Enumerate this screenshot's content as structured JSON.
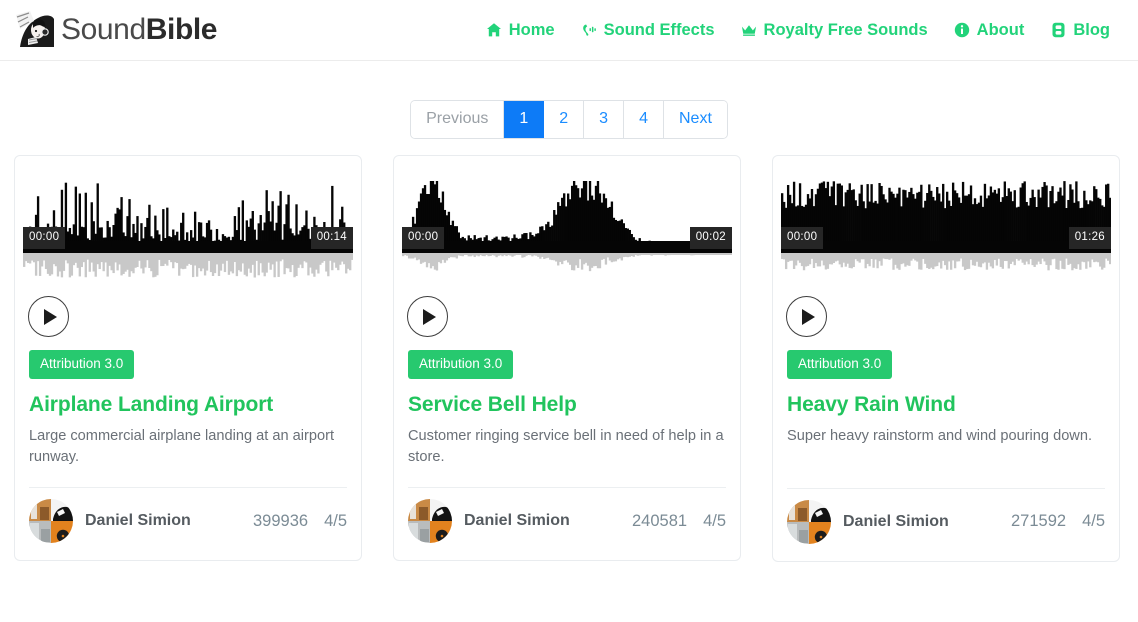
{
  "header": {
    "brand": {
      "light": "Sound",
      "bold": "Bible",
      "logo_icon": "soundbible-logo-icon"
    },
    "nav": [
      {
        "label": "Home",
        "icon": "home-icon"
      },
      {
        "label": "Sound Effects",
        "icon": "sound-wave-icon"
      },
      {
        "label": "Royalty Free Sounds",
        "icon": "crown-icon"
      },
      {
        "label": "About",
        "icon": "info-circle-icon"
      },
      {
        "label": "Blog",
        "icon": "book-icon"
      }
    ],
    "accent_color": "#22d37a"
  },
  "pagination": {
    "previous_label": "Previous",
    "next_label": "Next",
    "pages": [
      "1",
      "2",
      "3",
      "4"
    ],
    "active_page": "1",
    "active_bg": "#0d7bf7",
    "link_color": "#1a8cff",
    "disabled_color": "#9aa0a6"
  },
  "cards": [
    {
      "badge": "Attribution 3.0",
      "title": "Airplane Landing Airport",
      "description": "Large commercial airplane landing at an airport runway.",
      "author": "Daniel Simion",
      "downloads": "399936",
      "rating": "4/5",
      "time_start": "00:00",
      "time_end": "00:14",
      "play_icon": "play-icon",
      "avatar_icon": "author-avatar-icon",
      "waveform_kind": "spiky-dense"
    },
    {
      "badge": "Attribution 3.0",
      "title": "Service Bell Help",
      "description": "Customer ringing service bell in need of help in a store.",
      "author": "Daniel Simion",
      "downloads": "240581",
      "rating": "4/5",
      "time_start": "00:00",
      "time_end": "00:02",
      "play_icon": "play-icon",
      "avatar_icon": "author-avatar-icon",
      "waveform_kind": "two-bursts"
    },
    {
      "badge": "Attribution 3.0",
      "title": "Heavy Rain Wind",
      "description": "Super heavy rainstorm and wind pouring down.",
      "author": "Daniel Simion",
      "downloads": "271592",
      "rating": "4/5",
      "time_start": "00:00",
      "time_end": "01:26",
      "play_icon": "play-icon",
      "avatar_icon": "author-avatar-icon",
      "waveform_kind": "noise-solid"
    }
  ],
  "colors": {
    "badge_green": "#27c96f",
    "title_green": "#21c45d",
    "waveform_top": "#050505",
    "waveform_bottom": "#c8c8c8",
    "time_chip_bg": "#262626"
  }
}
